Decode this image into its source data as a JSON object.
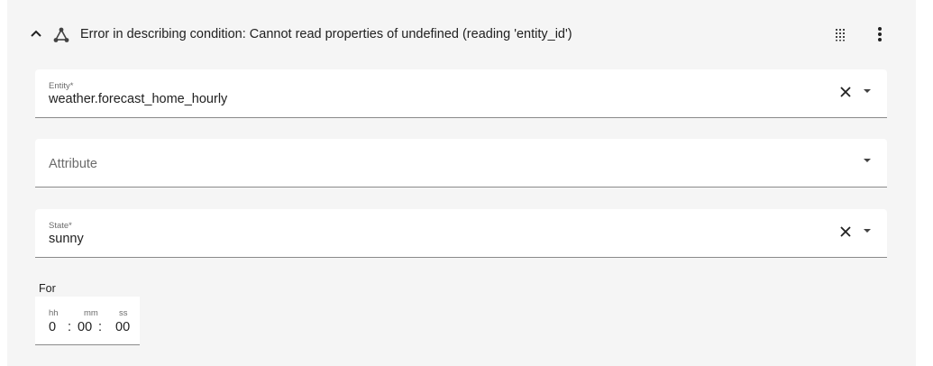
{
  "header": {
    "title": "Error in describing condition: Cannot read properties of undefined (reading 'entity_id')",
    "collapse_icon": "chevron-up-icon",
    "condition_icon": "condition-icon",
    "drag_icon": "drag-handle-icon",
    "menu_icon": "more-vertical-icon"
  },
  "entity_field": {
    "label": "Entity*",
    "value": "weather.forecast_home_hourly",
    "clear_icon": "close-icon",
    "dropdown_icon": "menu-down-icon"
  },
  "attribute_field": {
    "placeholder": "Attribute",
    "dropdown_icon": "menu-down-icon"
  },
  "state_field": {
    "label": "State*",
    "value": "sunny",
    "clear_icon": "close-icon",
    "dropdown_icon": "menu-down-icon"
  },
  "for": {
    "label": "For",
    "hours_label": "hh",
    "minutes_label": "mm",
    "seconds_label": "ss",
    "hours": "0",
    "minutes": "00",
    "seconds": "00",
    "separator": ":"
  },
  "colors": {
    "panel_background": "#f5f5f5",
    "field_background": "#ffffff",
    "text": "#212121",
    "secondary_text": "#6b6b6b",
    "underline": "#8a8a8a"
  }
}
